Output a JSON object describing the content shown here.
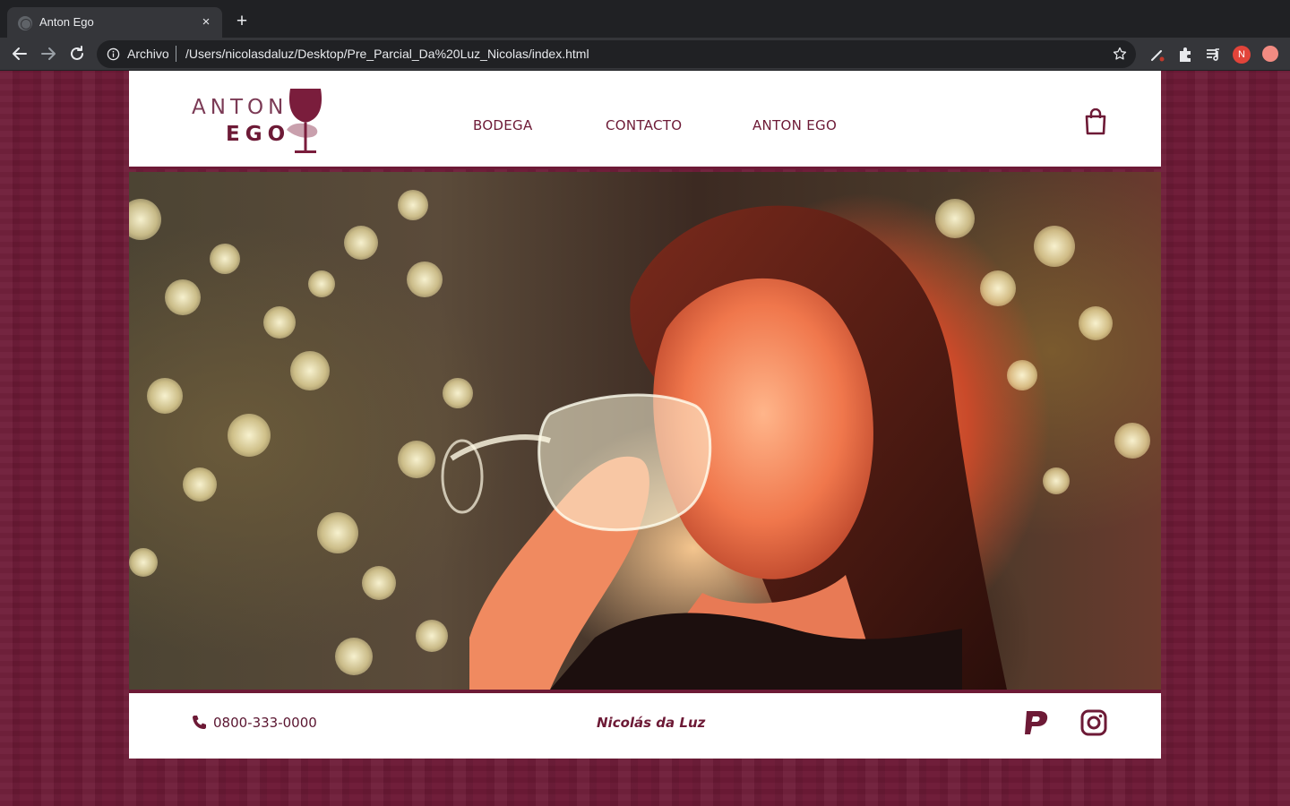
{
  "browser": {
    "tab_title": "Anton Ego",
    "tab_close": "×",
    "new_tab": "+",
    "omnibox_scheme": "Archivo",
    "omnibox_url": "/Users/nicolasdaluz/Desktop/Pre_Parcial_Da%20Luz_Nicolas/index.html",
    "profile_initial": "N"
  },
  "site": {
    "logo": {
      "line1": "ANTON",
      "line2": "EGO"
    },
    "nav": [
      {
        "label": "BODEGA"
      },
      {
        "label": "CONTACTO"
      },
      {
        "label": "ANTON EGO"
      }
    ],
    "footer": {
      "phone": "0800-333-0000",
      "author": "Nicolás da Luz"
    }
  },
  "colors": {
    "brand": "#6d1a36",
    "background": "#6d1a36",
    "header_bg": "#ffffff",
    "chrome_dark": "#202124",
    "chrome_toolbar": "#35363a"
  },
  "icons": [
    "back-arrow-icon",
    "forward-arrow-icon",
    "reload-icon",
    "info-icon",
    "star-icon",
    "pen-icon",
    "puzzle-icon",
    "media-queue-icon",
    "shopping-bag-icon",
    "phone-icon",
    "p-logo-icon",
    "instagram-icon",
    "wine-glass-icon"
  ]
}
